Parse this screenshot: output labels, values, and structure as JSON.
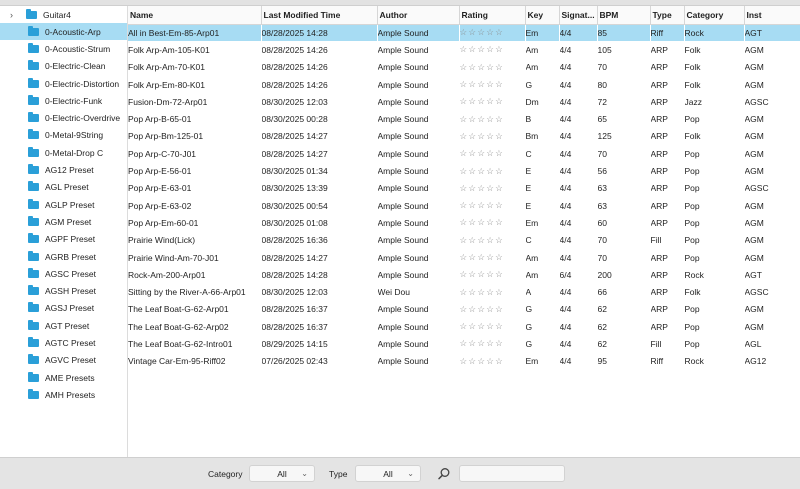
{
  "tree": {
    "root_label": "Guitar4",
    "items": [
      {
        "label": "0-Acoustic-Arp",
        "selected": true
      },
      {
        "label": "0-Acoustic-Strum"
      },
      {
        "label": "0-Electric-Clean"
      },
      {
        "label": "0-Electric-Distortion"
      },
      {
        "label": "0-Electric-Funk"
      },
      {
        "label": "0-Electric-Overdrive"
      },
      {
        "label": "0-Metal-9String"
      },
      {
        "label": "0-Metal-Drop C"
      },
      {
        "label": "AG12 Preset"
      },
      {
        "label": "AGL Preset"
      },
      {
        "label": "AGLP Preset"
      },
      {
        "label": "AGM Preset"
      },
      {
        "label": "AGPF Preset"
      },
      {
        "label": "AGRB Preset"
      },
      {
        "label": "AGSC Preset"
      },
      {
        "label": "AGSH Preset"
      },
      {
        "label": "AGSJ Preset"
      },
      {
        "label": "AGT Preset"
      },
      {
        "label": "AGTC Preset"
      },
      {
        "label": "AGVC Preset"
      },
      {
        "label": "AME Presets"
      },
      {
        "label": "AMH Presets"
      }
    ]
  },
  "table": {
    "columns": [
      "Name",
      "Last Modified Time",
      "Author",
      "Rating",
      "Key",
      "Signat...",
      "BPM",
      "Type",
      "Category",
      "Inst"
    ],
    "rating_glyphs": "☆☆☆☆☆",
    "rows": [
      [
        "All in Best-Em-85-Arp01",
        "08/28/2025 14:28",
        "Ample Sound",
        "",
        "Em",
        "4/4",
        "85",
        "Riff",
        "Rock",
        "AGT"
      ],
      [
        "Folk Arp-Am-105-K01",
        "08/28/2025 14:26",
        "Ample Sound",
        "",
        "Am",
        "4/4",
        "105",
        "ARP",
        "Folk",
        "AGM"
      ],
      [
        "Folk Arp-Am-70-K01",
        "08/28/2025 14:26",
        "Ample Sound",
        "",
        "Am",
        "4/4",
        "70",
        "ARP",
        "Folk",
        "AGM"
      ],
      [
        "Folk Arp-Em-80-K01",
        "08/28/2025 14:26",
        "Ample Sound",
        "",
        "G",
        "4/4",
        "80",
        "ARP",
        "Folk",
        "AGM"
      ],
      [
        "Fusion-Dm-72-Arp01",
        "08/30/2025 12:03",
        "Ample Sound",
        "",
        "Dm",
        "4/4",
        "72",
        "ARP",
        "Jazz",
        "AGSC"
      ],
      [
        "Pop Arp-B-65-01",
        "08/30/2025 00:28",
        "Ample Sound",
        "",
        "B",
        "4/4",
        "65",
        "ARP",
        "Pop",
        "AGM"
      ],
      [
        "Pop Arp-Bm-125-01",
        "08/28/2025 14:27",
        "Ample Sound",
        "",
        "Bm",
        "4/4",
        "125",
        "ARP",
        "Folk",
        "AGM"
      ],
      [
        "Pop Arp-C-70-J01",
        "08/28/2025 14:27",
        "Ample Sound",
        "",
        "C",
        "4/4",
        "70",
        "ARP",
        "Pop",
        "AGM"
      ],
      [
        "Pop Arp-E-56-01",
        "08/30/2025 01:34",
        "Ample Sound",
        "",
        "E",
        "4/4",
        "56",
        "ARP",
        "Pop",
        "AGM"
      ],
      [
        "Pop Arp-E-63-01",
        "08/30/2025 13:39",
        "Ample Sound",
        "",
        "E",
        "4/4",
        "63",
        "ARP",
        "Pop",
        "AGSC"
      ],
      [
        "Pop Arp-E-63-02",
        "08/30/2025 00:54",
        "Ample Sound",
        "",
        "E",
        "4/4",
        "63",
        "ARP",
        "Pop",
        "AGM"
      ],
      [
        "Pop Arp-Em-60-01",
        "08/30/2025 01:08",
        "Ample Sound",
        "",
        "Em",
        "4/4",
        "60",
        "ARP",
        "Pop",
        "AGM"
      ],
      [
        "Prairie Wind(Lick)",
        "08/28/2025 16:36",
        "Ample Sound",
        "",
        "C",
        "4/4",
        "70",
        "Fill",
        "Pop",
        "AGM"
      ],
      [
        "Prairie Wind-Am-70-J01",
        "08/28/2025 14:27",
        "Ample Sound",
        "",
        "Am",
        "4/4",
        "70",
        "ARP",
        "Pop",
        "AGM"
      ],
      [
        "Rock-Am-200-Arp01",
        "08/28/2025 14:28",
        "Ample Sound",
        "",
        "Am",
        "6/4",
        "200",
        "ARP",
        "Rock",
        "AGT"
      ],
      [
        "Sitting by the River-A-66-Arp01",
        "08/30/2025 12:03",
        "Wei Dou",
        "",
        "A",
        "4/4",
        "66",
        "ARP",
        "Folk",
        "AGSC"
      ],
      [
        "The Leaf Boat-G-62-Arp01",
        "08/28/2025 16:37",
        "Ample Sound",
        "",
        "G",
        "4/4",
        "62",
        "ARP",
        "Pop",
        "AGM"
      ],
      [
        "The Leaf Boat-G-62-Arp02",
        "08/28/2025 16:37",
        "Ample Sound",
        "",
        "G",
        "4/4",
        "62",
        "ARP",
        "Pop",
        "AGM"
      ],
      [
        "The Leaf Boat-G-62-Intro01",
        "08/29/2025 14:15",
        "Ample Sound",
        "",
        "G",
        "4/4",
        "62",
        "Fill",
        "Pop",
        "AGL"
      ],
      [
        "Vintage Car-Em-95-Riff02",
        "07/26/2025 02:43",
        "Ample Sound",
        "",
        "Em",
        "4/4",
        "95",
        "Riff",
        "Rock",
        "AG12"
      ]
    ],
    "selected_row": 0
  },
  "filters": {
    "category_label": "Category",
    "category_value": "All",
    "type_label": "Type",
    "type_value": "All",
    "search_placeholder": ""
  },
  "colors": {
    "selection": "#a7dcf3",
    "folder": "#2a9fd8"
  }
}
